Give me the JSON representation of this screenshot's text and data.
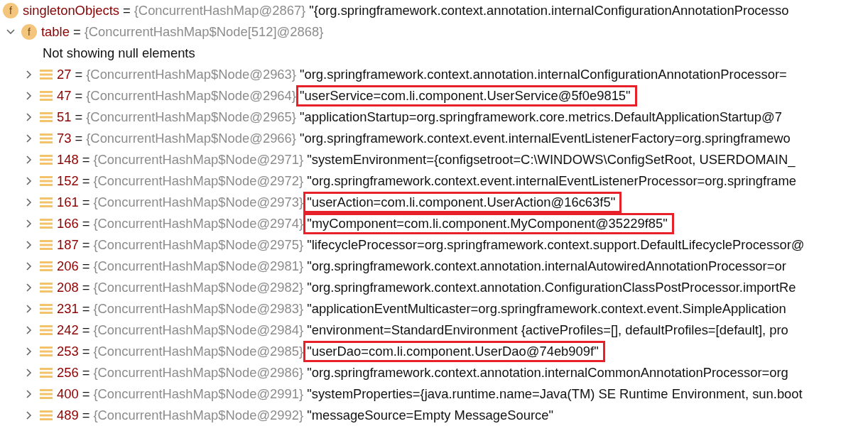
{
  "root": {
    "badge": "f",
    "name": "singletonObjects",
    "separator": "=",
    "type": "{ConcurrentHashMap@2867}",
    "value": "\"{org.springframework.context.annotation.internalConfigurationAnnotationProcesso"
  },
  "table": {
    "badge": "f",
    "name": "table",
    "separator": "=",
    "type": "{ConcurrentHashMap$Node[512]@2868}",
    "expanded": true,
    "note": "Not showing null elements",
    "entries": [
      {
        "key": "27",
        "separator": "=",
        "type": "{ConcurrentHashMap$Node@2963}",
        "value": "\"org.springframework.context.annotation.internalConfigurationAnnotationProcessor=",
        "expanded": false,
        "highlighted": false
      },
      {
        "key": "47",
        "separator": "=",
        "type": "{ConcurrentHashMap$Node@2964}",
        "value": "\"userService=com.li.component.UserService@5f0e9815\"",
        "expanded": false,
        "highlighted": true
      },
      {
        "key": "51",
        "separator": "=",
        "type": "{ConcurrentHashMap$Node@2965}",
        "value": "\"applicationStartup=org.springframework.core.metrics.DefaultApplicationStartup@7",
        "expanded": false,
        "highlighted": false
      },
      {
        "key": "73",
        "separator": "=",
        "type": "{ConcurrentHashMap$Node@2966}",
        "value": "\"org.springframework.context.event.internalEventListenerFactory=org.springframewo",
        "expanded": false,
        "highlighted": false
      },
      {
        "key": "148",
        "separator": "=",
        "type": "{ConcurrentHashMap$Node@2971}",
        "value": "\"systemEnvironment={configsetroot=C:\\WINDOWS\\ConfigSetRoot, USERDOMAIN_",
        "expanded": false,
        "highlighted": false
      },
      {
        "key": "152",
        "separator": "=",
        "type": "{ConcurrentHashMap$Node@2972}",
        "value": "\"org.springframework.context.event.internalEventListenerProcessor=org.springframe",
        "expanded": false,
        "highlighted": false
      },
      {
        "key": "161",
        "separator": "=",
        "type": "{ConcurrentHashMap$Node@2973}",
        "value": "\"userAction=com.li.component.UserAction@16c63f5\"",
        "expanded": false,
        "highlighted": true
      },
      {
        "key": "166",
        "separator": "=",
        "type": "{ConcurrentHashMap$Node@2974}",
        "value": "\"myComponent=com.li.component.MyComponent@35229f85\"",
        "expanded": false,
        "highlighted": true
      },
      {
        "key": "187",
        "separator": "=",
        "type": "{ConcurrentHashMap$Node@2975}",
        "value": "\"lifecycleProcessor=org.springframework.context.support.DefaultLifecycleProcessor@",
        "expanded": false,
        "highlighted": false
      },
      {
        "key": "206",
        "separator": "=",
        "type": "{ConcurrentHashMap$Node@2981}",
        "value": "\"org.springframework.context.annotation.internalAutowiredAnnotationProcessor=or",
        "expanded": false,
        "highlighted": false
      },
      {
        "key": "208",
        "separator": "=",
        "type": "{ConcurrentHashMap$Node@2982}",
        "value": "\"org.springframework.context.annotation.ConfigurationClassPostProcessor.importRe",
        "expanded": false,
        "highlighted": false
      },
      {
        "key": "231",
        "separator": "=",
        "type": "{ConcurrentHashMap$Node@2983}",
        "value": "\"applicationEventMulticaster=org.springframework.context.event.SimpleApplication",
        "expanded": false,
        "highlighted": false
      },
      {
        "key": "242",
        "separator": "=",
        "type": "{ConcurrentHashMap$Node@2984}",
        "value": "\"environment=StandardEnvironment {activeProfiles=[], defaultProfiles=[default], pro",
        "expanded": false,
        "highlighted": false
      },
      {
        "key": "253",
        "separator": "=",
        "type": "{ConcurrentHashMap$Node@2985}",
        "value": "\"userDao=com.li.component.UserDao@74eb909f\"",
        "expanded": false,
        "highlighted": true
      },
      {
        "key": "256",
        "separator": "=",
        "type": "{ConcurrentHashMap$Node@2986}",
        "value": "\"org.springframework.context.annotation.internalCommonAnnotationProcessor=org",
        "expanded": false,
        "highlighted": false
      },
      {
        "key": "400",
        "separator": "=",
        "type": "{ConcurrentHashMap$Node@2991}",
        "value": "\"systemProperties={java.runtime.name=Java(TM) SE Runtime Environment, sun.boot",
        "expanded": false,
        "highlighted": false
      },
      {
        "key": "489",
        "separator": "=",
        "type": "{ConcurrentHashMap$Node@2992}",
        "value": "\"messageSource=Empty MessageSource\"",
        "expanded": false,
        "highlighted": false
      }
    ]
  }
}
